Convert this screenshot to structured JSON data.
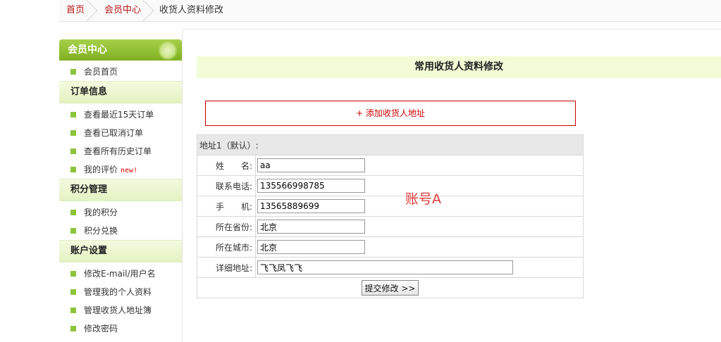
{
  "breadcrumb": {
    "home": "首页",
    "member_center": "会员中心",
    "current": "收货人资料修改"
  },
  "sidebar": {
    "title": "会员中心",
    "top_item": "会员首页",
    "sections": [
      {
        "title": "订单信息",
        "items": [
          {
            "label": "查看最近15天订单"
          },
          {
            "label": "查看已取消订单"
          },
          {
            "label": "查看所有历史订单"
          },
          {
            "label": "我的评价",
            "badge": "new!"
          }
        ]
      },
      {
        "title": "积分管理",
        "items": [
          {
            "label": "我的积分"
          },
          {
            "label": "积分兑换"
          }
        ]
      },
      {
        "title": "账户设置",
        "items": [
          {
            "label": "修改E-mail/用户名"
          },
          {
            "label": "管理我的个人资料"
          },
          {
            "label": "管理收货人地址簿"
          },
          {
            "label": "修改密码"
          }
        ]
      }
    ]
  },
  "main": {
    "title": "常用收货人资料修改",
    "add_address": "+ 添加收货人地址",
    "address_header": "地址1（默认）:",
    "fields": {
      "name": {
        "label": "姓　　名:",
        "value": "aa"
      },
      "phone": {
        "label": "联系电话:",
        "value": "135566998785"
      },
      "mobile": {
        "label": "手　　机:",
        "value": "13565889699"
      },
      "province": {
        "label": "所在省份:",
        "value": "北京"
      },
      "city": {
        "label": "所在城市:",
        "value": "北京"
      },
      "address": {
        "label": "详细地址:",
        "value": "飞飞凤飞飞"
      }
    },
    "submit_label": "提交修改 >>",
    "annotation": "账号A"
  },
  "colors": {
    "accent_green": "#8cc43c",
    "link_red": "#b5171a",
    "title_bg": "#f2fcd6"
  }
}
